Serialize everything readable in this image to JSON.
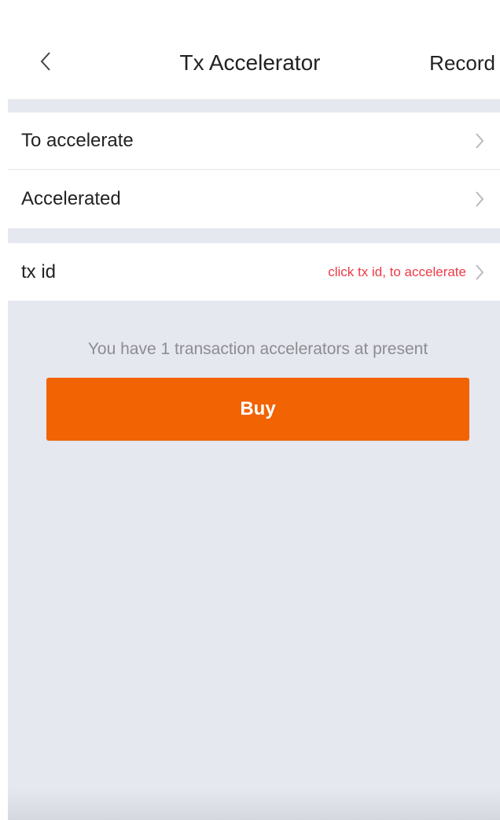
{
  "header": {
    "title": "Tx Accelerator",
    "record_label": "Record",
    "back_icon": "chevron-left-icon"
  },
  "rows": [
    {
      "label": "To accelerate",
      "icon": "chevron-right-icon"
    },
    {
      "label": "Accelerated",
      "icon": "chevron-right-icon"
    }
  ],
  "txid_row": {
    "label": "tx id",
    "hint": "click tx id, to accelerate",
    "icon": "chevron-right-icon"
  },
  "info": {
    "text": "You have 1 transaction accelerators at present"
  },
  "buy": {
    "label": "Buy"
  },
  "colors": {
    "accent": "#f26304",
    "hint": "#ee3a46",
    "background": "#e6e8ef"
  }
}
